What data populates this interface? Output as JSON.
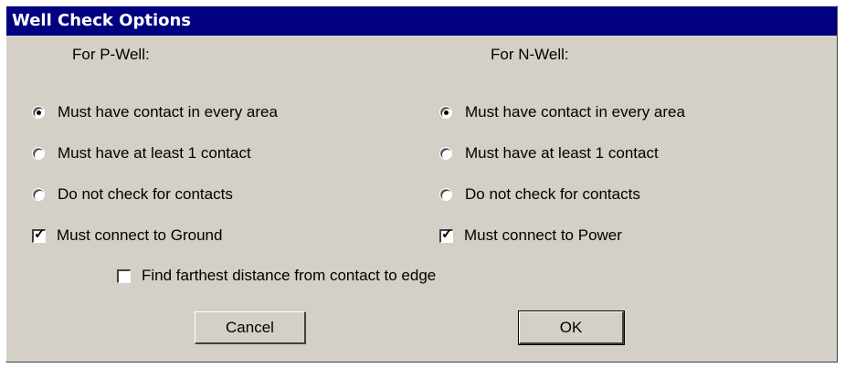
{
  "dialog": {
    "title": "Well Check Options"
  },
  "pwell": {
    "heading": "For P-Well:",
    "options": [
      {
        "label": "Must have contact in every area",
        "selected": true
      },
      {
        "label": "Must have at least 1 contact",
        "selected": false
      },
      {
        "label": "Do not check for contacts",
        "selected": false
      }
    ],
    "connect": {
      "label": "Must connect to Ground",
      "checked": true
    }
  },
  "nwell": {
    "heading": "For N-Well:",
    "options": [
      {
        "label": "Must have contact in every area",
        "selected": true
      },
      {
        "label": "Must have at least 1 contact",
        "selected": false
      },
      {
        "label": "Do not check for contacts",
        "selected": false
      }
    ],
    "connect": {
      "label": "Must connect to Power",
      "checked": true
    }
  },
  "farthest": {
    "label": "Find farthest distance from contact to edge",
    "checked": false
  },
  "buttons": {
    "cancel": "Cancel",
    "ok": "OK"
  },
  "glyphs": {
    "check_mark": "✓"
  }
}
